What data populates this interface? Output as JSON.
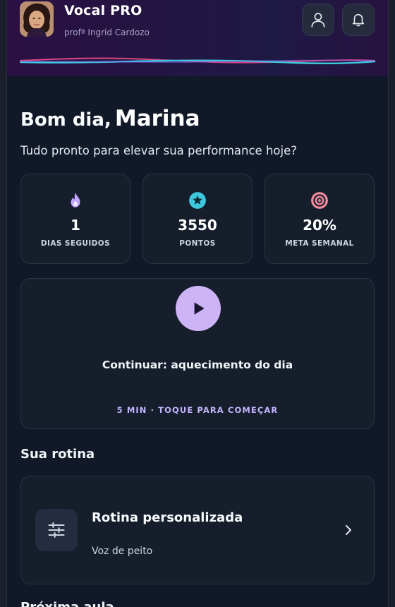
{
  "header": {
    "app_name": "Vocal PRO",
    "teacher": "profª Ingrid Cardozo",
    "user_icon": "user-icon",
    "bell_icon": "bell-icon"
  },
  "greeting": {
    "prefix": "Bom dia,",
    "name": "Marina",
    "subtitle": "Tudo pronto para elevar sua performance hoje?"
  },
  "stats": [
    {
      "icon": "flame-icon",
      "value": "1",
      "label": "DIAS SEGUIDOS",
      "color": "#c4a5ff"
    },
    {
      "icon": "star-badge-icon",
      "value": "3550",
      "label": "PONTOS",
      "color": "#3ec8de"
    },
    {
      "icon": "target-icon",
      "value": "20%",
      "label": "META SEMANAL",
      "color": "#f08c9c"
    }
  ],
  "continue_card": {
    "icon": "play-icon",
    "title": "Continuar: aquecimento do dia",
    "meta": "5 MIN · TOQUE PARA COMEÇAR"
  },
  "routine": {
    "section_title": "Sua rotina",
    "card_title": "Rotina personalizada",
    "card_subtitle": "Voz de peito",
    "icon": "sliders-icon"
  },
  "next_section_title": "Próxima aula",
  "colors": {
    "background": "#111827",
    "card": "#161d2b",
    "accent_purple": "#cdb4f7",
    "accent_teal": "#3ec8de",
    "accent_pink": "#f08c9c"
  }
}
